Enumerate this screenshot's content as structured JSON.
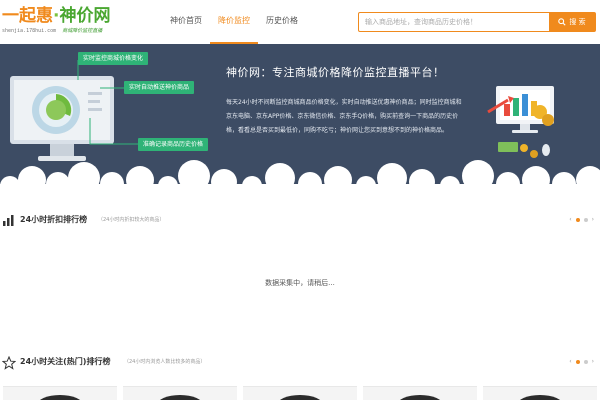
{
  "header": {
    "logo": {
      "main_a": "一起惠",
      "sep": "·",
      "main_b": "神价网",
      "url": "shenjia.178hui.com",
      "slogan": "商城降价监控直播"
    },
    "nav": [
      {
        "label": "神价首页",
        "active": false
      },
      {
        "label": "降价监控",
        "active": true
      },
      {
        "label": "历史价格",
        "active": false
      }
    ],
    "search": {
      "placeholder": "输入商品地址，查询商品历史价格！",
      "button_label": "搜 索",
      "button_icon": "search-icon"
    },
    "accent_color": "#f08a1d"
  },
  "banner": {
    "tags": [
      "实时监控商城价格变化",
      "实时自动推送神价商品",
      "准确记录商品历史价格"
    ],
    "title": "神价网：专注商城价格降价监控直播平台！",
    "description": "每天24小时不间断监控商城商品价格变化，实时自动推送优惠神价商品；同时监控商城和京东电脑、京东APP价格、京东微信价格、京东手Q价格，购买前查询一下商品的历史价格，看看总是否买到最低价，同购不吃亏；神价网让您买到意想不到的神价格商品。",
    "background": "#3d4c64"
  },
  "section_hot_discount": {
    "icon": "bar-chart-icon",
    "title": "24小时折扣排行榜",
    "subtitle": "（24小时内折扣较大的商品）",
    "loading_text": "数据采集中，请稍后...",
    "pager": {
      "prev": "‹",
      "next": "›",
      "dots": 2,
      "active_dot": 1
    }
  },
  "section_hot_attention": {
    "icon": "star-icon",
    "title": "24小时关注(热门)排行榜",
    "subtitle": "（24小时内浏览人数比较多的商品）",
    "pager": {
      "prev": "‹",
      "next": "›",
      "dots": 2,
      "active_dot": 1
    }
  }
}
